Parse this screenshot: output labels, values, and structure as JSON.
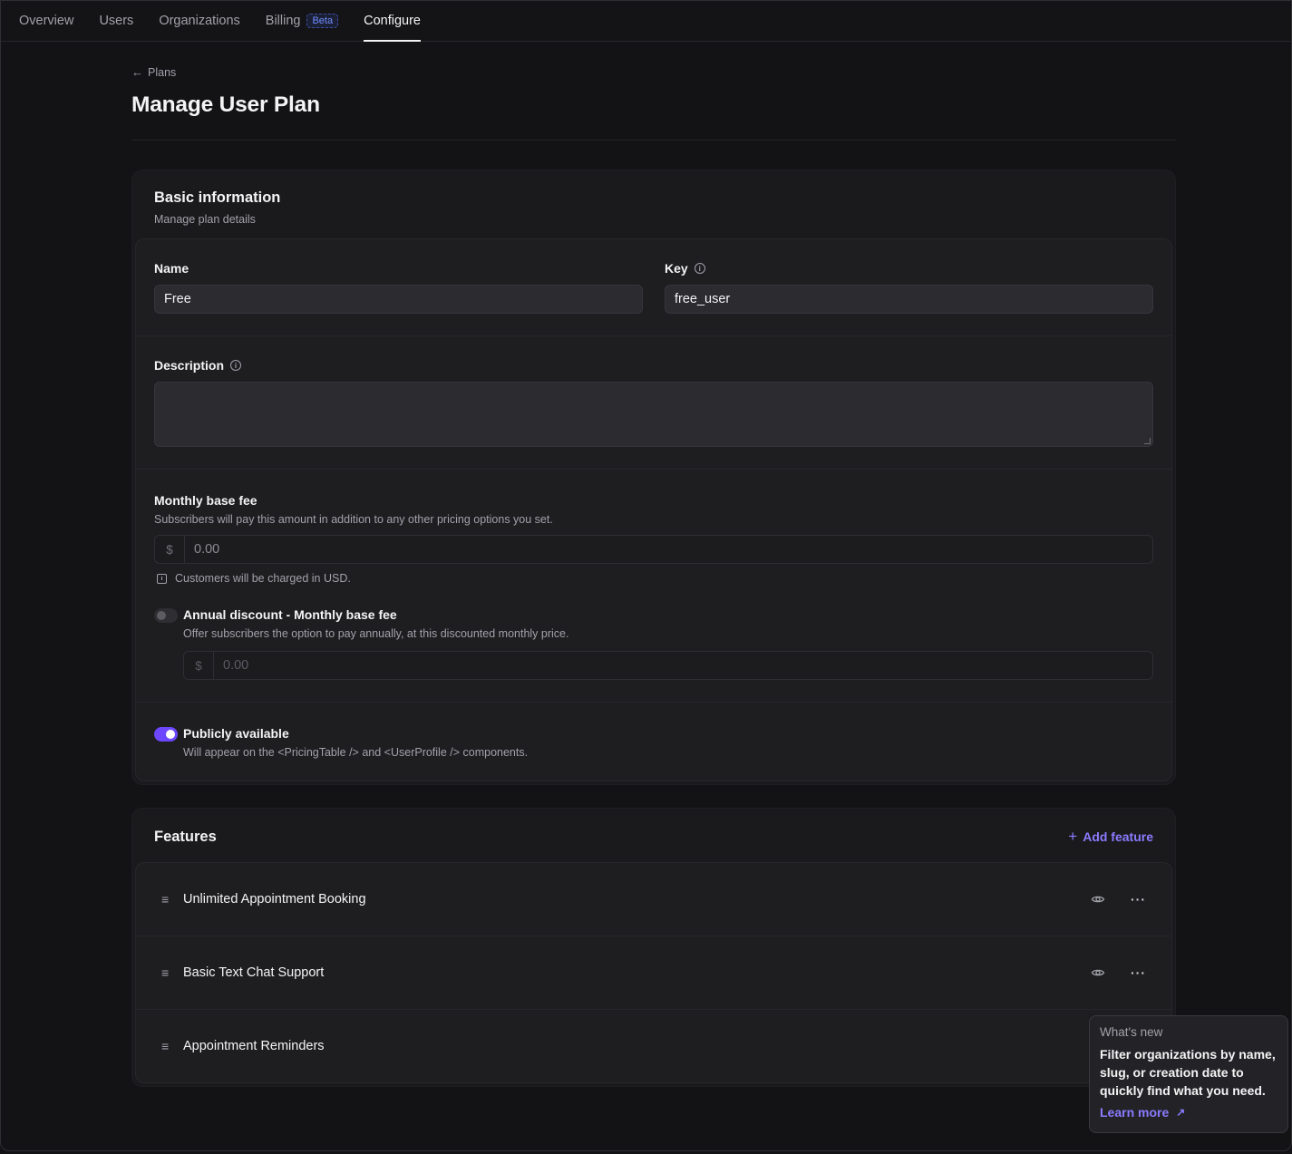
{
  "nav": {
    "tabs": [
      {
        "label": "Overview"
      },
      {
        "label": "Users"
      },
      {
        "label": "Organizations"
      },
      {
        "label": "Billing",
        "badge": "Beta"
      },
      {
        "label": "Configure",
        "active": true
      }
    ]
  },
  "breadcrumb": {
    "back_label": "Plans"
  },
  "page_title": "Manage User Plan",
  "basic_info": {
    "title": "Basic information",
    "subtitle": "Manage plan details",
    "name_label": "Name",
    "name_value": "Free",
    "key_label": "Key",
    "key_value": "free_user",
    "description_label": "Description",
    "description_value": ""
  },
  "pricing": {
    "monthly_title": "Monthly base fee",
    "monthly_hint": "Subscribers will pay this amount in addition to any other pricing options you set.",
    "currency_symbol": "$",
    "monthly_placeholder": "0.00",
    "usd_note": "Customers will be charged in USD.",
    "annual_title": "Annual discount - Monthly base fee",
    "annual_hint": "Offer subscribers the option to pay annually, at this discounted monthly price.",
    "annual_placeholder": "0.00",
    "annual_enabled": false
  },
  "visibility": {
    "title": "Publicly available",
    "hint": "Will appear on the <PricingTable /> and <UserProfile /> components.",
    "enabled": true
  },
  "features": {
    "title": "Features",
    "add_label": "Add feature",
    "items": [
      {
        "name": "Unlimited Appointment Booking"
      },
      {
        "name": "Basic Text Chat Support"
      },
      {
        "name": "Appointment Reminders"
      }
    ]
  },
  "whats_new": {
    "title": "What's new",
    "text": "Filter organizations by name, slug, or creation date to quickly find what you need.",
    "link": "Learn more"
  },
  "colors": {
    "accent": "#6c47ff",
    "link": "#8b7bff",
    "background": "#131316"
  }
}
